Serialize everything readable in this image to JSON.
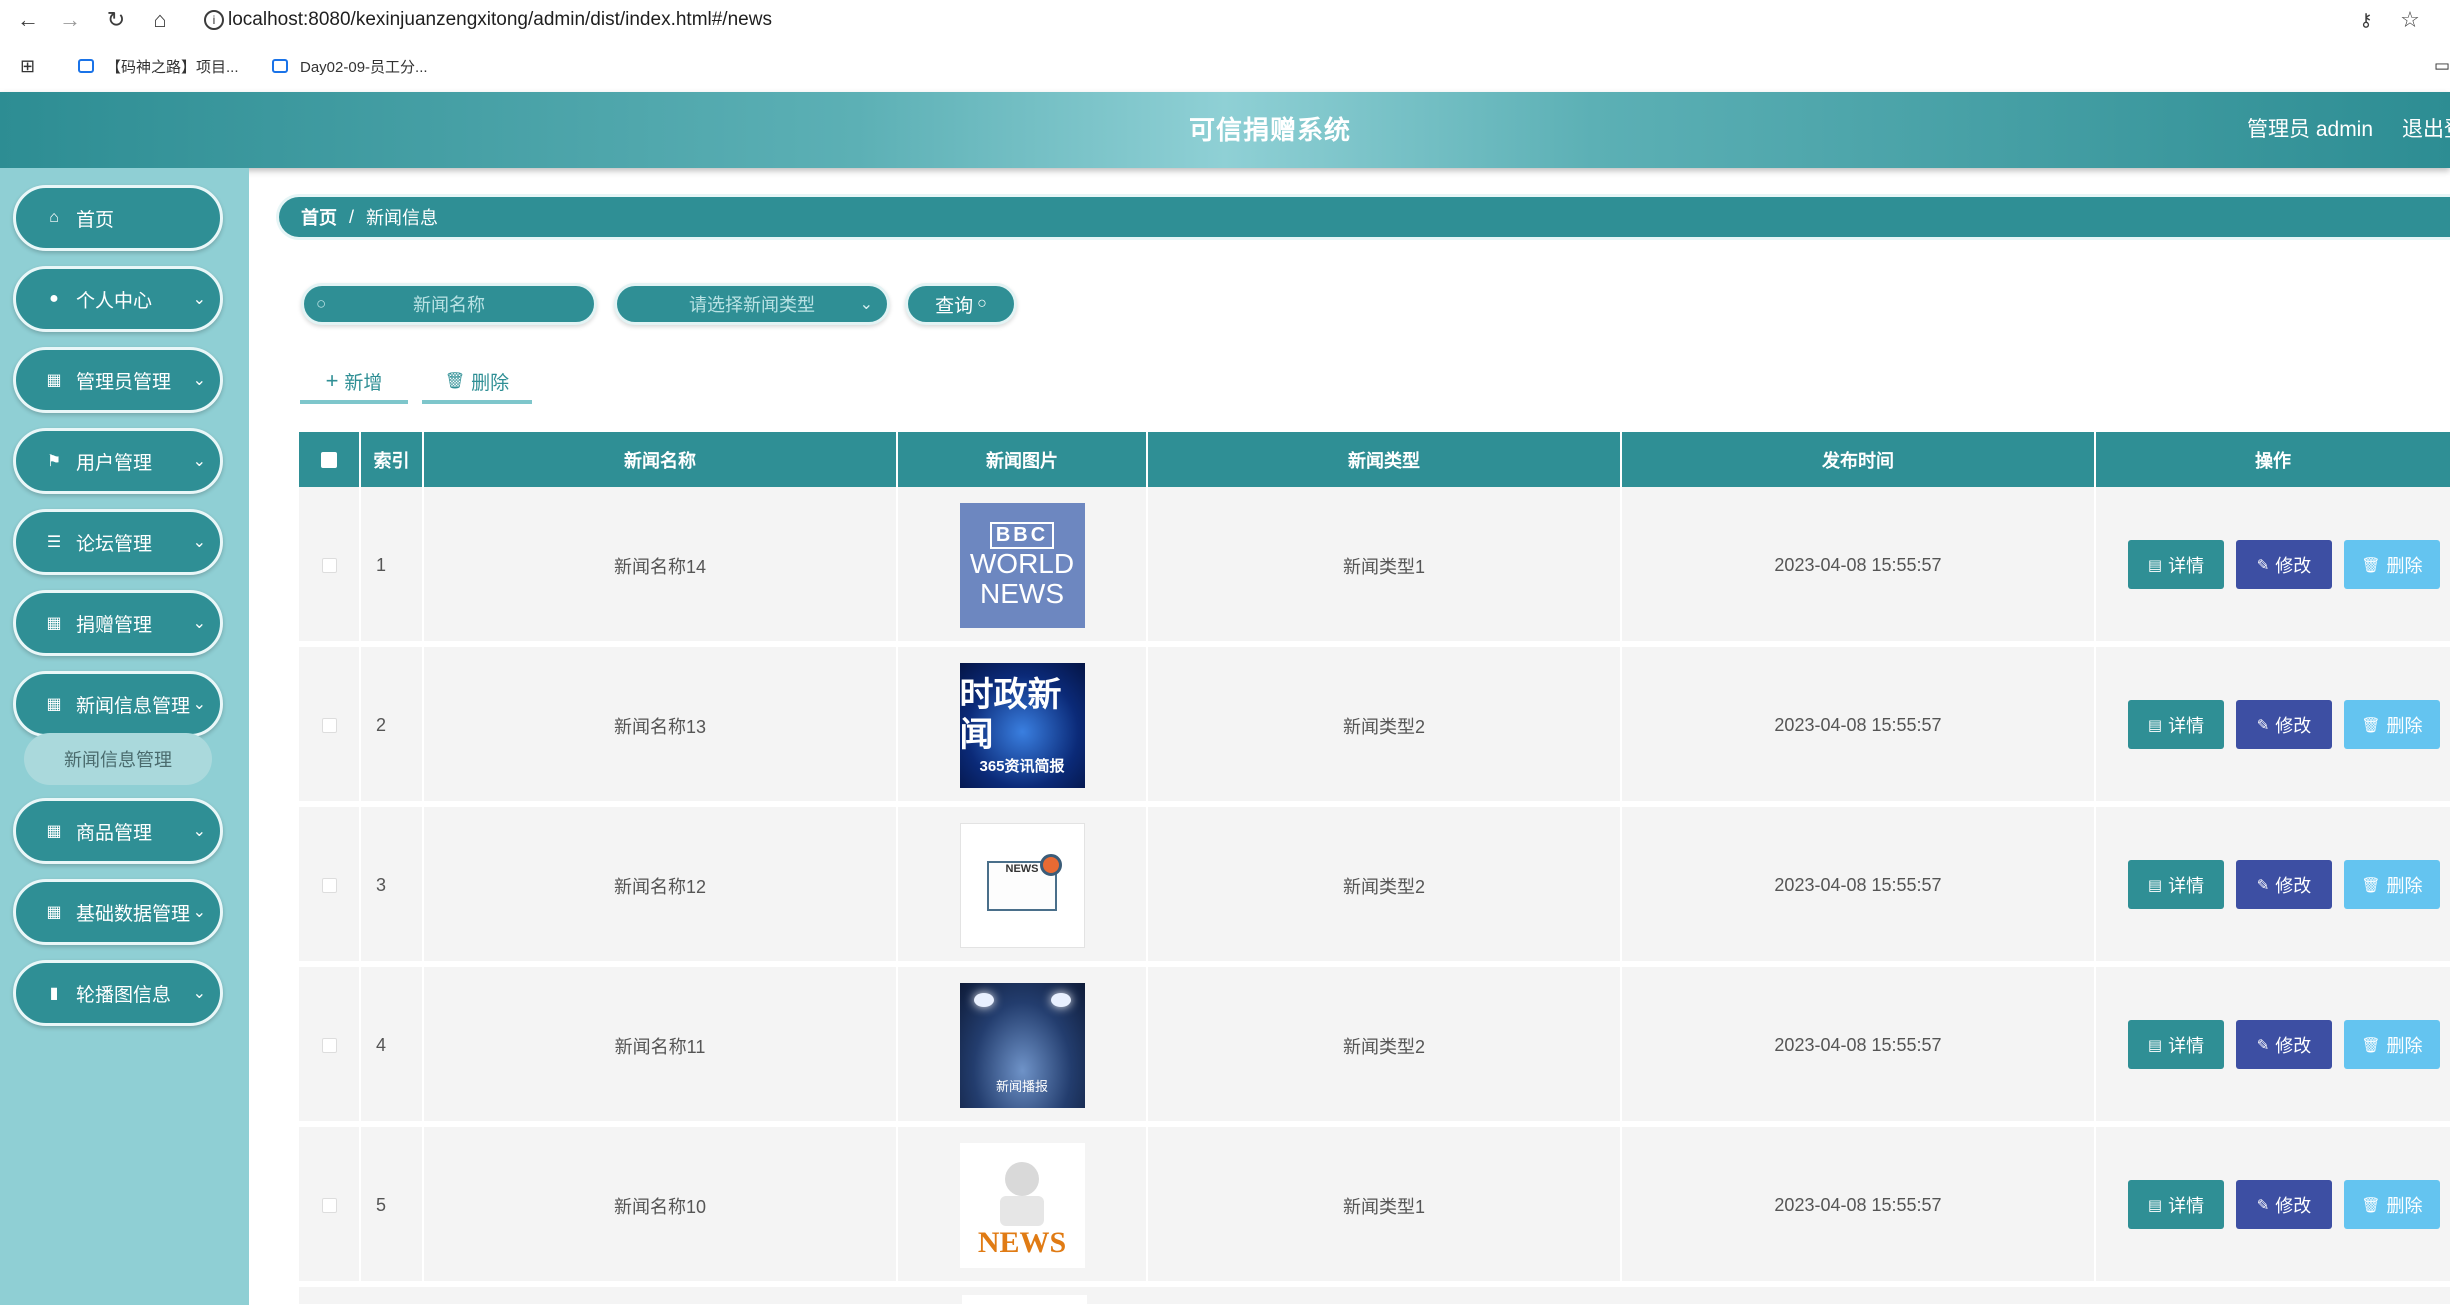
{
  "browser": {
    "url": "localhost:8080/kexinjuanzengxitong/admin/dist/index.html#/news",
    "bookmarks": [
      "【码神之路】项目...",
      "Day02-09-员工分..."
    ]
  },
  "header": {
    "title": "可信捐赠系统",
    "admin": "管理员 admin",
    "logout": "退出登"
  },
  "sidebar": {
    "items": [
      {
        "label": "首页",
        "icon": "home-icon"
      },
      {
        "label": "个人中心",
        "icon": "user-icon"
      },
      {
        "label": "管理员管理",
        "icon": "grid-icon"
      },
      {
        "label": "用户管理",
        "icon": "flag-icon"
      },
      {
        "label": "论坛管理",
        "icon": "sliders-icon"
      },
      {
        "label": "捐赠管理",
        "icon": "grid-icon"
      },
      {
        "label": "新闻信息管理",
        "icon": "grid-icon"
      },
      {
        "label": "商品管理",
        "icon": "grid-icon"
      },
      {
        "label": "基础数据管理",
        "icon": "grid-icon"
      },
      {
        "label": "轮播图信息",
        "icon": "chart-icon"
      }
    ],
    "submenu": "新闻信息管理"
  },
  "breadcrumb": {
    "home": "首页",
    "sep": "/",
    "current": "新闻信息"
  },
  "search": {
    "name_placeholder": "新闻名称",
    "type_placeholder": "请选择新闻类型",
    "query_label": "查询"
  },
  "actions": {
    "add": "新增",
    "delete": "删除"
  },
  "table": {
    "headers": [
      "索引",
      "新闻名称",
      "新闻图片",
      "新闻类型",
      "发布时间",
      "操作"
    ],
    "rows": [
      {
        "index": "1",
        "name": "新闻名称14",
        "type": "新闻类型1",
        "time": "2023-04-08 15:55:57",
        "img_text": [
          "BBC",
          "WORLD",
          "NEWS"
        ]
      },
      {
        "index": "2",
        "name": "新闻名称13",
        "type": "新闻类型2",
        "time": "2023-04-08 15:55:57",
        "img_text": [
          "时政新闻",
          "365资讯简报"
        ]
      },
      {
        "index": "3",
        "name": "新闻名称12",
        "type": "新闻类型2",
        "time": "2023-04-08 15:55:57",
        "img_text": [
          "NEWS"
        ]
      },
      {
        "index": "4",
        "name": "新闻名称11",
        "type": "新闻类型2",
        "time": "2023-04-08 15:55:57",
        "img_text": [
          "新闻播报"
        ]
      },
      {
        "index": "5",
        "name": "新闻名称10",
        "type": "新闻类型1",
        "time": "2023-04-08 15:55:57",
        "img_text": [
          "NEWS"
        ]
      }
    ],
    "op_detail": "详情",
    "op_edit": "修改",
    "op_delete": "删除"
  },
  "colors": {
    "primary": "#2f8f95",
    "sidebar": "#8fcfd4",
    "edit": "#3d4fa3",
    "delete": "#64c4f0"
  }
}
